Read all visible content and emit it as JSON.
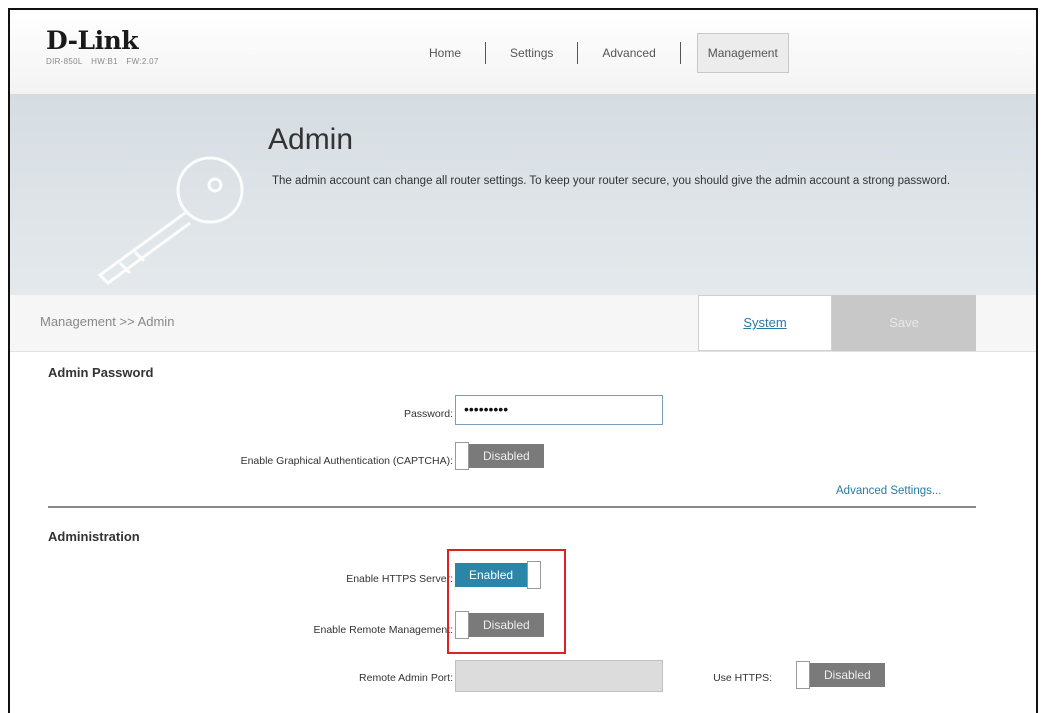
{
  "header": {
    "logo": "D-Link",
    "model": "DIR-850L",
    "hw": "HW:B1",
    "fw": "FW:2.07",
    "nav": [
      "Home",
      "Settings",
      "Advanced",
      "Management"
    ]
  },
  "banner": {
    "title": "Admin",
    "description": "The admin account can change all router settings. To keep your router secure, you should give the admin account a strong password."
  },
  "breadcrumb": {
    "path": "Management >> Admin",
    "system_label": "System",
    "save_label": "Save"
  },
  "admin_password": {
    "title": "Admin Password",
    "password_label": "Password:",
    "password_value": "•••••••••",
    "captcha_label": "Enable Graphical Authentication (CAPTCHA):",
    "captcha_state": "Disabled",
    "advanced_link": "Advanced Settings..."
  },
  "administration": {
    "title": "Administration",
    "https_label": "Enable HTTPS Server:",
    "https_state": "Enabled",
    "remote_label": "Enable Remote Management:",
    "remote_state": "Disabled",
    "port_label": "Remote Admin Port:",
    "port_value": "",
    "use_https_label": "Use HTTPS:",
    "use_https_state": "Disabled"
  },
  "colors": {
    "accent": "#2a86a8",
    "disabled_toggle": "#7a7a7a",
    "highlight": "#dd2222"
  }
}
